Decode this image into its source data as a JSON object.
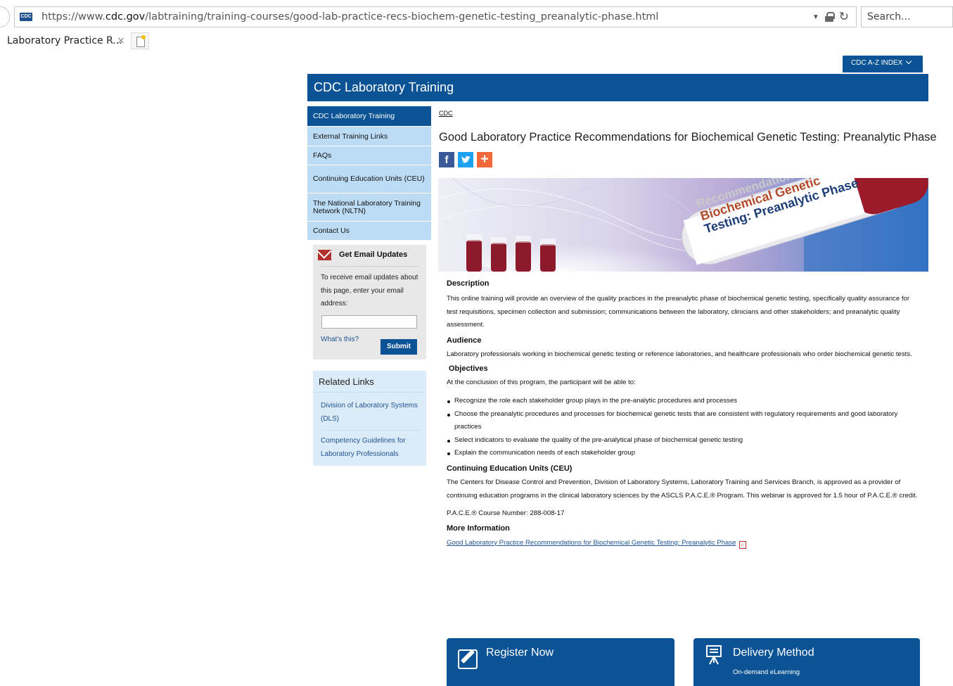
{
  "browser": {
    "url_prefix": "https://www.",
    "url_domain": "cdc.gov",
    "url_path": "/labtraining/training-courses/good-lab-practice-recs-biochem-genetic-testing_preanalytic-phase.html",
    "search_placeholder": "Search...",
    "tab_title": "Laboratory Practice R...",
    "tab_close": "×"
  },
  "header": {
    "az_index": "CDC A-Z INDEX",
    "site_title": "CDC Laboratory Training"
  },
  "leftnav": {
    "items": [
      {
        "label": "CDC Laboratory Training",
        "active": true
      },
      {
        "label": "External Training Links"
      },
      {
        "label": "FAQs"
      },
      {
        "label": "Continuing Education Units (CEU)"
      },
      {
        "label": "The National Laboratory Training Network (NLTN)"
      },
      {
        "label": "Contact Us"
      }
    ]
  },
  "email_updates": {
    "title": "Get Email Updates",
    "text": "To receive email updates about this page, enter your email address:",
    "input_placeholder": "",
    "whats_this": "What's this?",
    "submit": "Submit"
  },
  "related": {
    "title": "Related Links",
    "links": [
      "Division of Laboratory Systems (DLS)",
      "Competency Guidelines for Laboratory Professionals"
    ]
  },
  "main": {
    "breadcrumb": "CDC",
    "title": "Good Laboratory Practice Recommendations for Biochemical Genetic Testing: Preanalytic Phase",
    "hero_text": [
      "Recommendations for",
      "Biochemical Genetic",
      "Testing: Preanalytic Phase"
    ],
    "description_heading": "Description",
    "description": "This online training will provide an overview of the quality practices in the preanalytic phase of biochemical genetic testing, specifically quality assurance for test requisitions, specimen collection and submission; communications between the laboratory, clinicians and other stakeholders; and preanalytic quality assessment.",
    "audience_heading": "Audience",
    "audience": "Laboratory professionals working in biochemical genetic testing or reference laboratories, and healthcare professionals who order biochemical genetic tests.",
    "objectives_heading": "Objectives",
    "objectives_intro": "At the conclusion of this program, the participant will be able to:",
    "objectives": [
      "Recognize the role each stakeholder group plays in the pre-analytic procedures and processes",
      "Choose the preanalytic procedures and processes for biochemical genetic tests that are consistent with regulatory requirements and good laboratory practices",
      "Select indicators to evaluate the quality of the pre-analytical phase of biochemical genetic testing",
      "Explain the communication needs of each stakeholder group"
    ],
    "ceu_heading": "Continuing Education Units (CEU)",
    "ceu_text": "The Centers for Disease Control and Prevention, Division of Laboratory Systems, Laboratory Training and Services Branch, is approved as a provider of continuing education programs in the clinical laboratory sciences by the ASCLS P.A.C.E.® Program. This webinar is approved for 1.5 hour of P.A.C.E.® credit.",
    "pace_number": "P.A.C.E.® Course Number: 288-008-17",
    "more_info_heading": "More Information",
    "more_info_link": "Good Laboratory Practice Recommendations for Biochemical Genetic Testing: Preanalytic Phase"
  },
  "cards": {
    "register": "Register Now",
    "delivery_title": "Delivery Method",
    "delivery_value": "On-demand eLearning"
  }
}
